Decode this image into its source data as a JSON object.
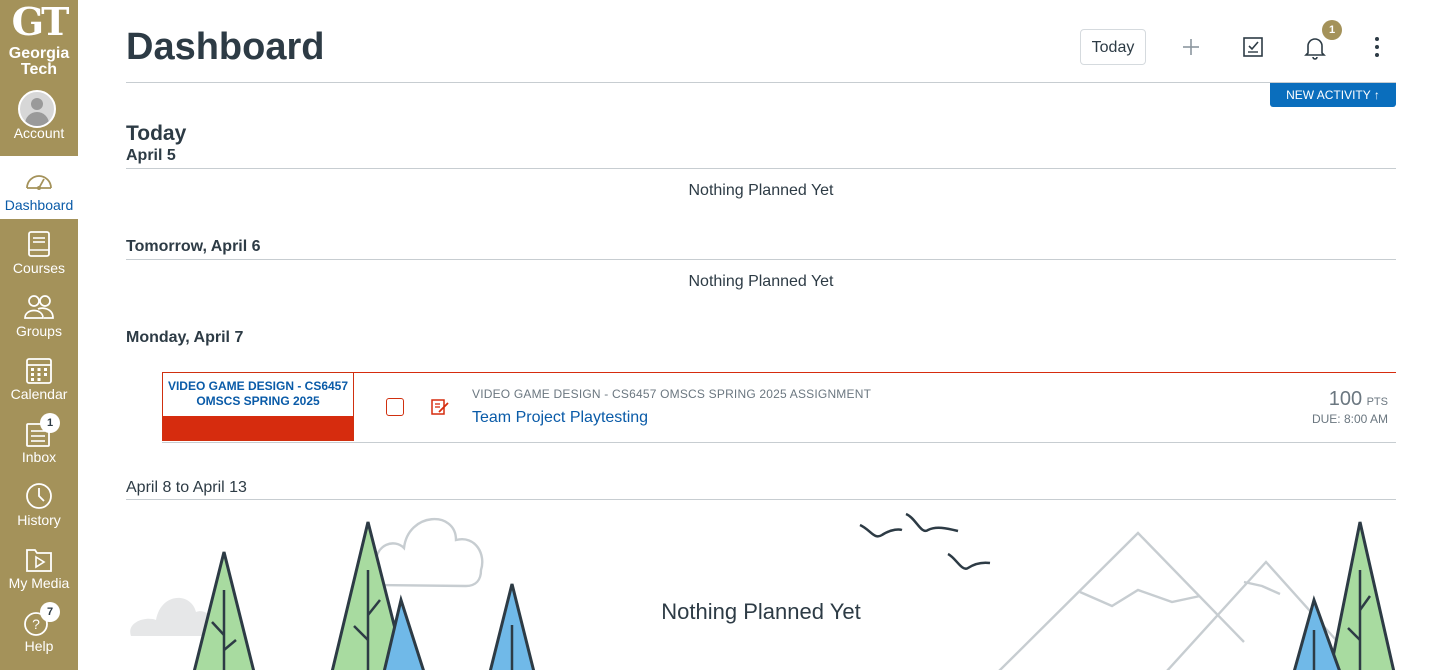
{
  "brand": {
    "logo_mark": "GT",
    "logo_text": "Georgia Tech",
    "color": "#a4925a"
  },
  "nav": [
    {
      "label": "Account",
      "icon": "avatar"
    },
    {
      "label": "Dashboard",
      "icon": "dashboard-icon",
      "active": true
    },
    {
      "label": "Courses",
      "icon": "courses-icon"
    },
    {
      "label": "Groups",
      "icon": "groups-icon"
    },
    {
      "label": "Calendar",
      "icon": "calendar-icon"
    },
    {
      "label": "Inbox",
      "icon": "inbox-icon",
      "badge": "1"
    },
    {
      "label": "History",
      "icon": "history-icon"
    },
    {
      "label": "My Media",
      "icon": "media-icon"
    },
    {
      "label": "Help",
      "icon": "help-icon",
      "badge": "7"
    }
  ],
  "header": {
    "title": "Dashboard",
    "today_button": "Today",
    "notification_count": "1",
    "new_activity": "NEW ACTIVITY ↑"
  },
  "planner": {
    "sections": [
      {
        "heading": "Today",
        "date": "April 5",
        "empty_text": "Nothing Planned Yet"
      },
      {
        "heading": "Tomorrow, April 6",
        "empty_text": "Nothing Planned Yet"
      },
      {
        "heading": "Monday, April 7"
      }
    ],
    "item": {
      "course_label": "VIDEO GAME DESIGN - CS6457 OMSCS SPRING 2025",
      "context": "VIDEO GAME DESIGN - CS6457 OMSCS SPRING 2025 ASSIGNMENT",
      "title": "Team Project Playtesting",
      "points": "100",
      "points_unit": "PTS",
      "due": "DUE: 8:00 AM",
      "course_color": "#d62c0e"
    },
    "range": {
      "heading": "April 8 to April 13",
      "empty_text": "Nothing Planned Yet"
    }
  }
}
